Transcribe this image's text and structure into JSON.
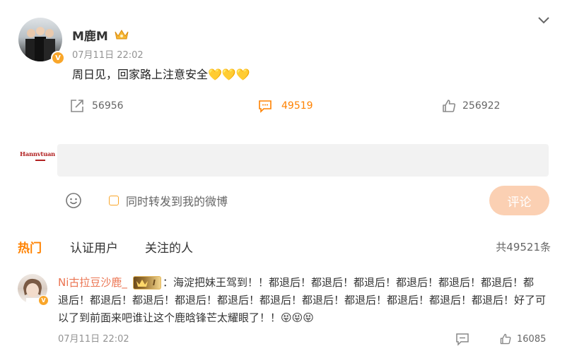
{
  "post": {
    "author": "M鹿M",
    "timestamp": "07月11日 22:02",
    "text": "周日见，回家路上注意安全💛💛💛",
    "actions": {
      "repost_count": "56956",
      "comment_count": "49519",
      "like_count": "256922"
    }
  },
  "composer": {
    "logo_text": "Hannvtuan",
    "repost_label": "同时转发到我的微博",
    "submit_label": "评论"
  },
  "comments_header": {
    "tabs": [
      "热门",
      "认证用户",
      "关注的人"
    ],
    "total": "共49521条"
  },
  "comment": {
    "user": "Ni古拉豆沙鹿_",
    "badge_level": "I",
    "text_line1": "：海淀把妹王驾到！！都退后！都退后！都退后！都退后！都退后！都退后！都",
    "text_line2": "退后！都退后！都退后！都退后！都退后！都退后！都退后！都退后！都退后！都退后！都退后！好了可",
    "text_line3": "以了到前面来吧谁让这个鹿晗锋芒太耀眼了！！😝😝😝",
    "timestamp": "07月11日 22:02",
    "like_count": "16085"
  },
  "colors": {
    "accent_orange": "#ff8200",
    "submit_bg": "#fbd0b3",
    "verified_badge": "#f9a62a"
  }
}
